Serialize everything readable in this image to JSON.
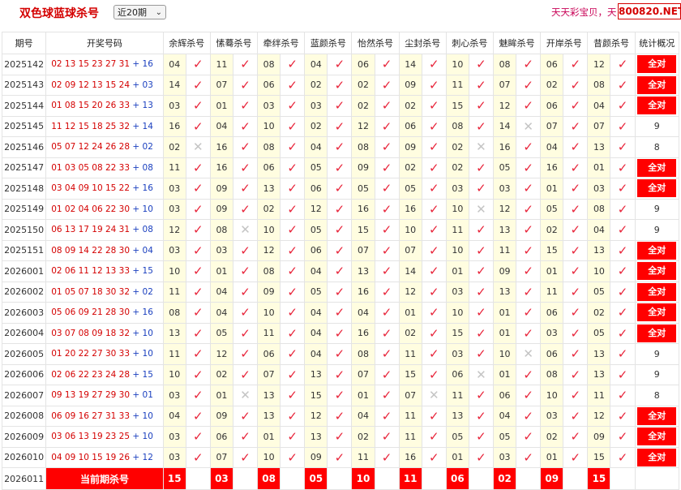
{
  "header": {
    "title": "双色球蓝球杀号",
    "period_select": "近20期",
    "marquee": "天天彩宝贝，天",
    "site_badge": "800820.NET"
  },
  "columns": [
    "期号",
    "开奖号码",
    "余辉杀号",
    "愫蓦杀号",
    "牵绊杀号",
    "蓝颜杀号",
    "怡然杀号",
    "尘封杀号",
    "刺心杀号",
    "魅眸杀号",
    "开岸杀号",
    "昔颜杀号",
    "统计概况"
  ],
  "rows": [
    {
      "issue": "2025142",
      "red": "02 13 15 23 27 31",
      "blue": "16",
      "kills": [
        "04",
        "11",
        "08",
        "04",
        "06",
        "14",
        "10",
        "08",
        "06",
        "12"
      ],
      "hits": [
        1,
        1,
        1,
        1,
        1,
        1,
        1,
        1,
        1,
        1
      ],
      "stat": "全对"
    },
    {
      "issue": "2025143",
      "red": "02 09 12 13 15 24",
      "blue": "03",
      "kills": [
        "14",
        "07",
        "06",
        "02",
        "02",
        "09",
        "11",
        "07",
        "02",
        "08"
      ],
      "hits": [
        1,
        1,
        1,
        1,
        1,
        1,
        1,
        1,
        1,
        1
      ],
      "stat": "全对"
    },
    {
      "issue": "2025144",
      "red": "01 08 15 20 26 33",
      "blue": "13",
      "kills": [
        "03",
        "01",
        "03",
        "03",
        "02",
        "02",
        "15",
        "12",
        "06",
        "04"
      ],
      "hits": [
        1,
        1,
        1,
        1,
        1,
        1,
        1,
        1,
        1,
        1
      ],
      "stat": "全对"
    },
    {
      "issue": "2025145",
      "red": "11 12 15 18 25 32",
      "blue": "14",
      "kills": [
        "16",
        "04",
        "10",
        "02",
        "12",
        "06",
        "08",
        "14",
        "07",
        "07"
      ],
      "hits": [
        1,
        1,
        1,
        1,
        1,
        1,
        1,
        0,
        1,
        1
      ],
      "stat": "9"
    },
    {
      "issue": "2025146",
      "red": "05 07 12 24 26 28",
      "blue": "02",
      "kills": [
        "02",
        "16",
        "08",
        "04",
        "08",
        "09",
        "02",
        "16",
        "04",
        "13"
      ],
      "hits": [
        0,
        1,
        1,
        1,
        1,
        1,
        0,
        1,
        1,
        1
      ],
      "stat": "8"
    },
    {
      "issue": "2025147",
      "red": "01 03 05 08 22 33",
      "blue": "08",
      "kills": [
        "11",
        "16",
        "06",
        "05",
        "09",
        "02",
        "02",
        "05",
        "16",
        "01"
      ],
      "hits": [
        1,
        1,
        1,
        1,
        1,
        1,
        1,
        1,
        1,
        1
      ],
      "stat": "全对"
    },
    {
      "issue": "2025148",
      "red": "03 04 09 10 15 22",
      "blue": "16",
      "kills": [
        "03",
        "09",
        "13",
        "06",
        "05",
        "05",
        "03",
        "03",
        "01",
        "03"
      ],
      "hits": [
        1,
        1,
        1,
        1,
        1,
        1,
        1,
        1,
        1,
        1
      ],
      "stat": "全对"
    },
    {
      "issue": "2025149",
      "red": "01 02 04 06 22 30",
      "blue": "10",
      "kills": [
        "03",
        "09",
        "02",
        "12",
        "16",
        "16",
        "10",
        "12",
        "05",
        "08"
      ],
      "hits": [
        1,
        1,
        1,
        1,
        1,
        1,
        0,
        1,
        1,
        1
      ],
      "stat": "9"
    },
    {
      "issue": "2025150",
      "red": "06 13 17 19 24 31",
      "blue": "08",
      "kills": [
        "12",
        "08",
        "10",
        "05",
        "15",
        "10",
        "11",
        "13",
        "02",
        "04"
      ],
      "hits": [
        1,
        0,
        1,
        1,
        1,
        1,
        1,
        1,
        1,
        1
      ],
      "stat": "9"
    },
    {
      "issue": "2025151",
      "red": "08 09 14 22 28 30",
      "blue": "04",
      "kills": [
        "03",
        "03",
        "12",
        "06",
        "07",
        "07",
        "10",
        "11",
        "15",
        "13"
      ],
      "hits": [
        1,
        1,
        1,
        1,
        1,
        1,
        1,
        1,
        1,
        1
      ],
      "stat": "全对"
    },
    {
      "issue": "2026001",
      "red": "02 06 11 12 13 33",
      "blue": "15",
      "kills": [
        "10",
        "01",
        "08",
        "04",
        "13",
        "14",
        "01",
        "09",
        "01",
        "10"
      ],
      "hits": [
        1,
        1,
        1,
        1,
        1,
        1,
        1,
        1,
        1,
        1
      ],
      "stat": "全对"
    },
    {
      "issue": "2026002",
      "red": "01 05 07 18 30 32",
      "blue": "02",
      "kills": [
        "11",
        "04",
        "09",
        "05",
        "16",
        "12",
        "03",
        "13",
        "11",
        "05"
      ],
      "hits": [
        1,
        1,
        1,
        1,
        1,
        1,
        1,
        1,
        1,
        1
      ],
      "stat": "全对"
    },
    {
      "issue": "2026003",
      "red": "05 06 09 21 28 30",
      "blue": "16",
      "kills": [
        "08",
        "04",
        "10",
        "04",
        "04",
        "01",
        "10",
        "01",
        "06",
        "02"
      ],
      "hits": [
        1,
        1,
        1,
        1,
        1,
        1,
        1,
        1,
        1,
        1
      ],
      "stat": "全对"
    },
    {
      "issue": "2026004",
      "red": "03 07 08 09 18 32",
      "blue": "10",
      "kills": [
        "13",
        "05",
        "11",
        "04",
        "16",
        "02",
        "15",
        "01",
        "03",
        "05"
      ],
      "hits": [
        1,
        1,
        1,
        1,
        1,
        1,
        1,
        1,
        1,
        1
      ],
      "stat": "全对"
    },
    {
      "issue": "2026005",
      "red": "01 20 22 27 30 33",
      "blue": "10",
      "kills": [
        "11",
        "12",
        "06",
        "04",
        "08",
        "11",
        "03",
        "10",
        "06",
        "13"
      ],
      "hits": [
        1,
        1,
        1,
        1,
        1,
        1,
        1,
        0,
        1,
        1
      ],
      "stat": "9"
    },
    {
      "issue": "2026006",
      "red": "02 06 22 23 24 28",
      "blue": "15",
      "kills": [
        "10",
        "02",
        "07",
        "13",
        "07",
        "15",
        "06",
        "01",
        "08",
        "13"
      ],
      "hits": [
        1,
        1,
        1,
        1,
        1,
        1,
        0,
        1,
        1,
        1
      ],
      "stat": "9"
    },
    {
      "issue": "2026007",
      "red": "09 13 19 27 29 30",
      "blue": "01",
      "kills": [
        "03",
        "01",
        "13",
        "15",
        "01",
        "07",
        "11",
        "06",
        "10",
        "11"
      ],
      "hits": [
        1,
        0,
        1,
        1,
        1,
        0,
        1,
        1,
        1,
        1
      ],
      "stat": "8"
    },
    {
      "issue": "2026008",
      "red": "06 09 16 27 31 33",
      "blue": "10",
      "kills": [
        "04",
        "09",
        "13",
        "12",
        "04",
        "11",
        "13",
        "04",
        "03",
        "12"
      ],
      "hits": [
        1,
        1,
        1,
        1,
        1,
        1,
        1,
        1,
        1,
        1
      ],
      "stat": "全对"
    },
    {
      "issue": "2026009",
      "red": "03 06 13 19 23 25",
      "blue": "10",
      "kills": [
        "03",
        "06",
        "01",
        "13",
        "02",
        "11",
        "05",
        "05",
        "02",
        "09"
      ],
      "hits": [
        1,
        1,
        1,
        1,
        1,
        1,
        1,
        1,
        1,
        1
      ],
      "stat": "全对"
    },
    {
      "issue": "2026010",
      "red": "04 09 10 15 19 26",
      "blue": "12",
      "kills": [
        "03",
        "07",
        "10",
        "09",
        "11",
        "16",
        "01",
        "03",
        "01",
        "15"
      ],
      "hits": [
        1,
        1,
        1,
        1,
        1,
        1,
        1,
        1,
        1,
        1
      ],
      "stat": "全对"
    }
  ],
  "current": {
    "issue": "2026011",
    "label": "当前期杀号",
    "kills": [
      "15",
      "03",
      "08",
      "05",
      "10",
      "11",
      "06",
      "02",
      "09",
      "15"
    ]
  },
  "symbols": {
    "hit": "✓",
    "miss": "✕",
    "plus": "+"
  },
  "colors": {
    "accent_red": "#d40000",
    "badge_red": "#ff0000",
    "blue_ball": "#1a3fbf",
    "kill_bg": "#fffde0"
  }
}
